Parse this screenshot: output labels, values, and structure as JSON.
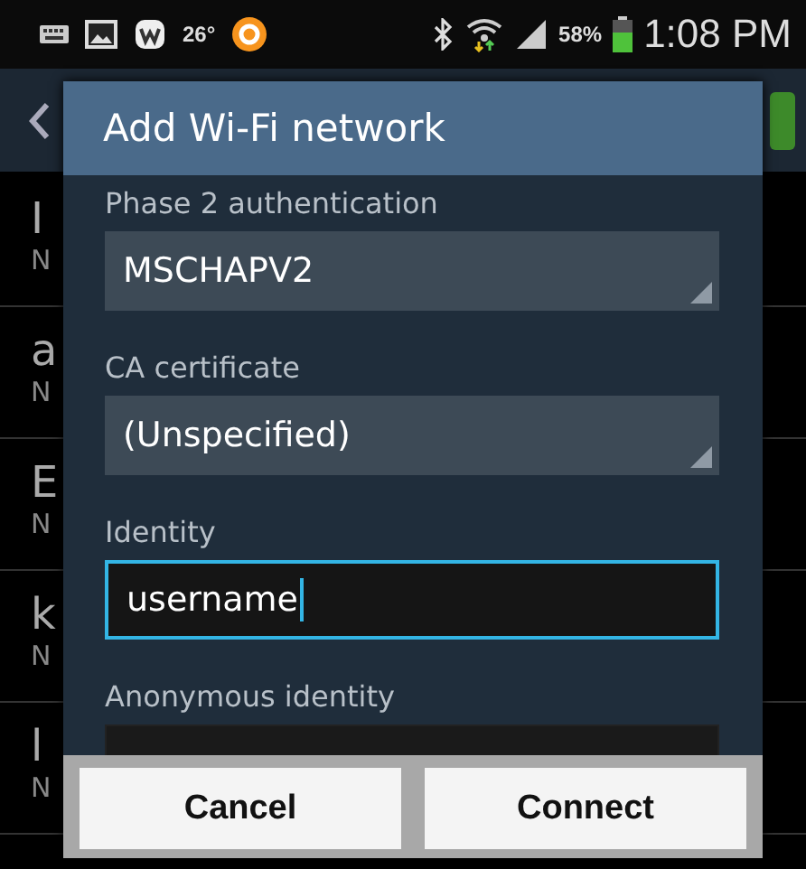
{
  "status_bar": {
    "weather": "26°",
    "battery": "58%",
    "time": "1:08 PM"
  },
  "background_list": [
    {
      "title": "I",
      "subtitle": "N"
    },
    {
      "title": "a",
      "subtitle": "N"
    },
    {
      "title": "E",
      "subtitle": "N"
    },
    {
      "title": "k",
      "subtitle": "N"
    },
    {
      "title": "l",
      "subtitle": "N"
    }
  ],
  "dialog": {
    "title": "Add Wi-Fi network",
    "fields": [
      {
        "kind": "select",
        "label": "Phase 2 authentication",
        "value": "MSCHAPV2"
      },
      {
        "kind": "select",
        "label": "CA certificate",
        "value": "(Unspecified)"
      },
      {
        "kind": "input",
        "label": "Identity",
        "value": "username",
        "focused": true
      },
      {
        "kind": "input",
        "label": "Anonymous identity",
        "focused": false
      }
    ],
    "buttons": [
      "Cancel",
      "Connect"
    ]
  }
}
